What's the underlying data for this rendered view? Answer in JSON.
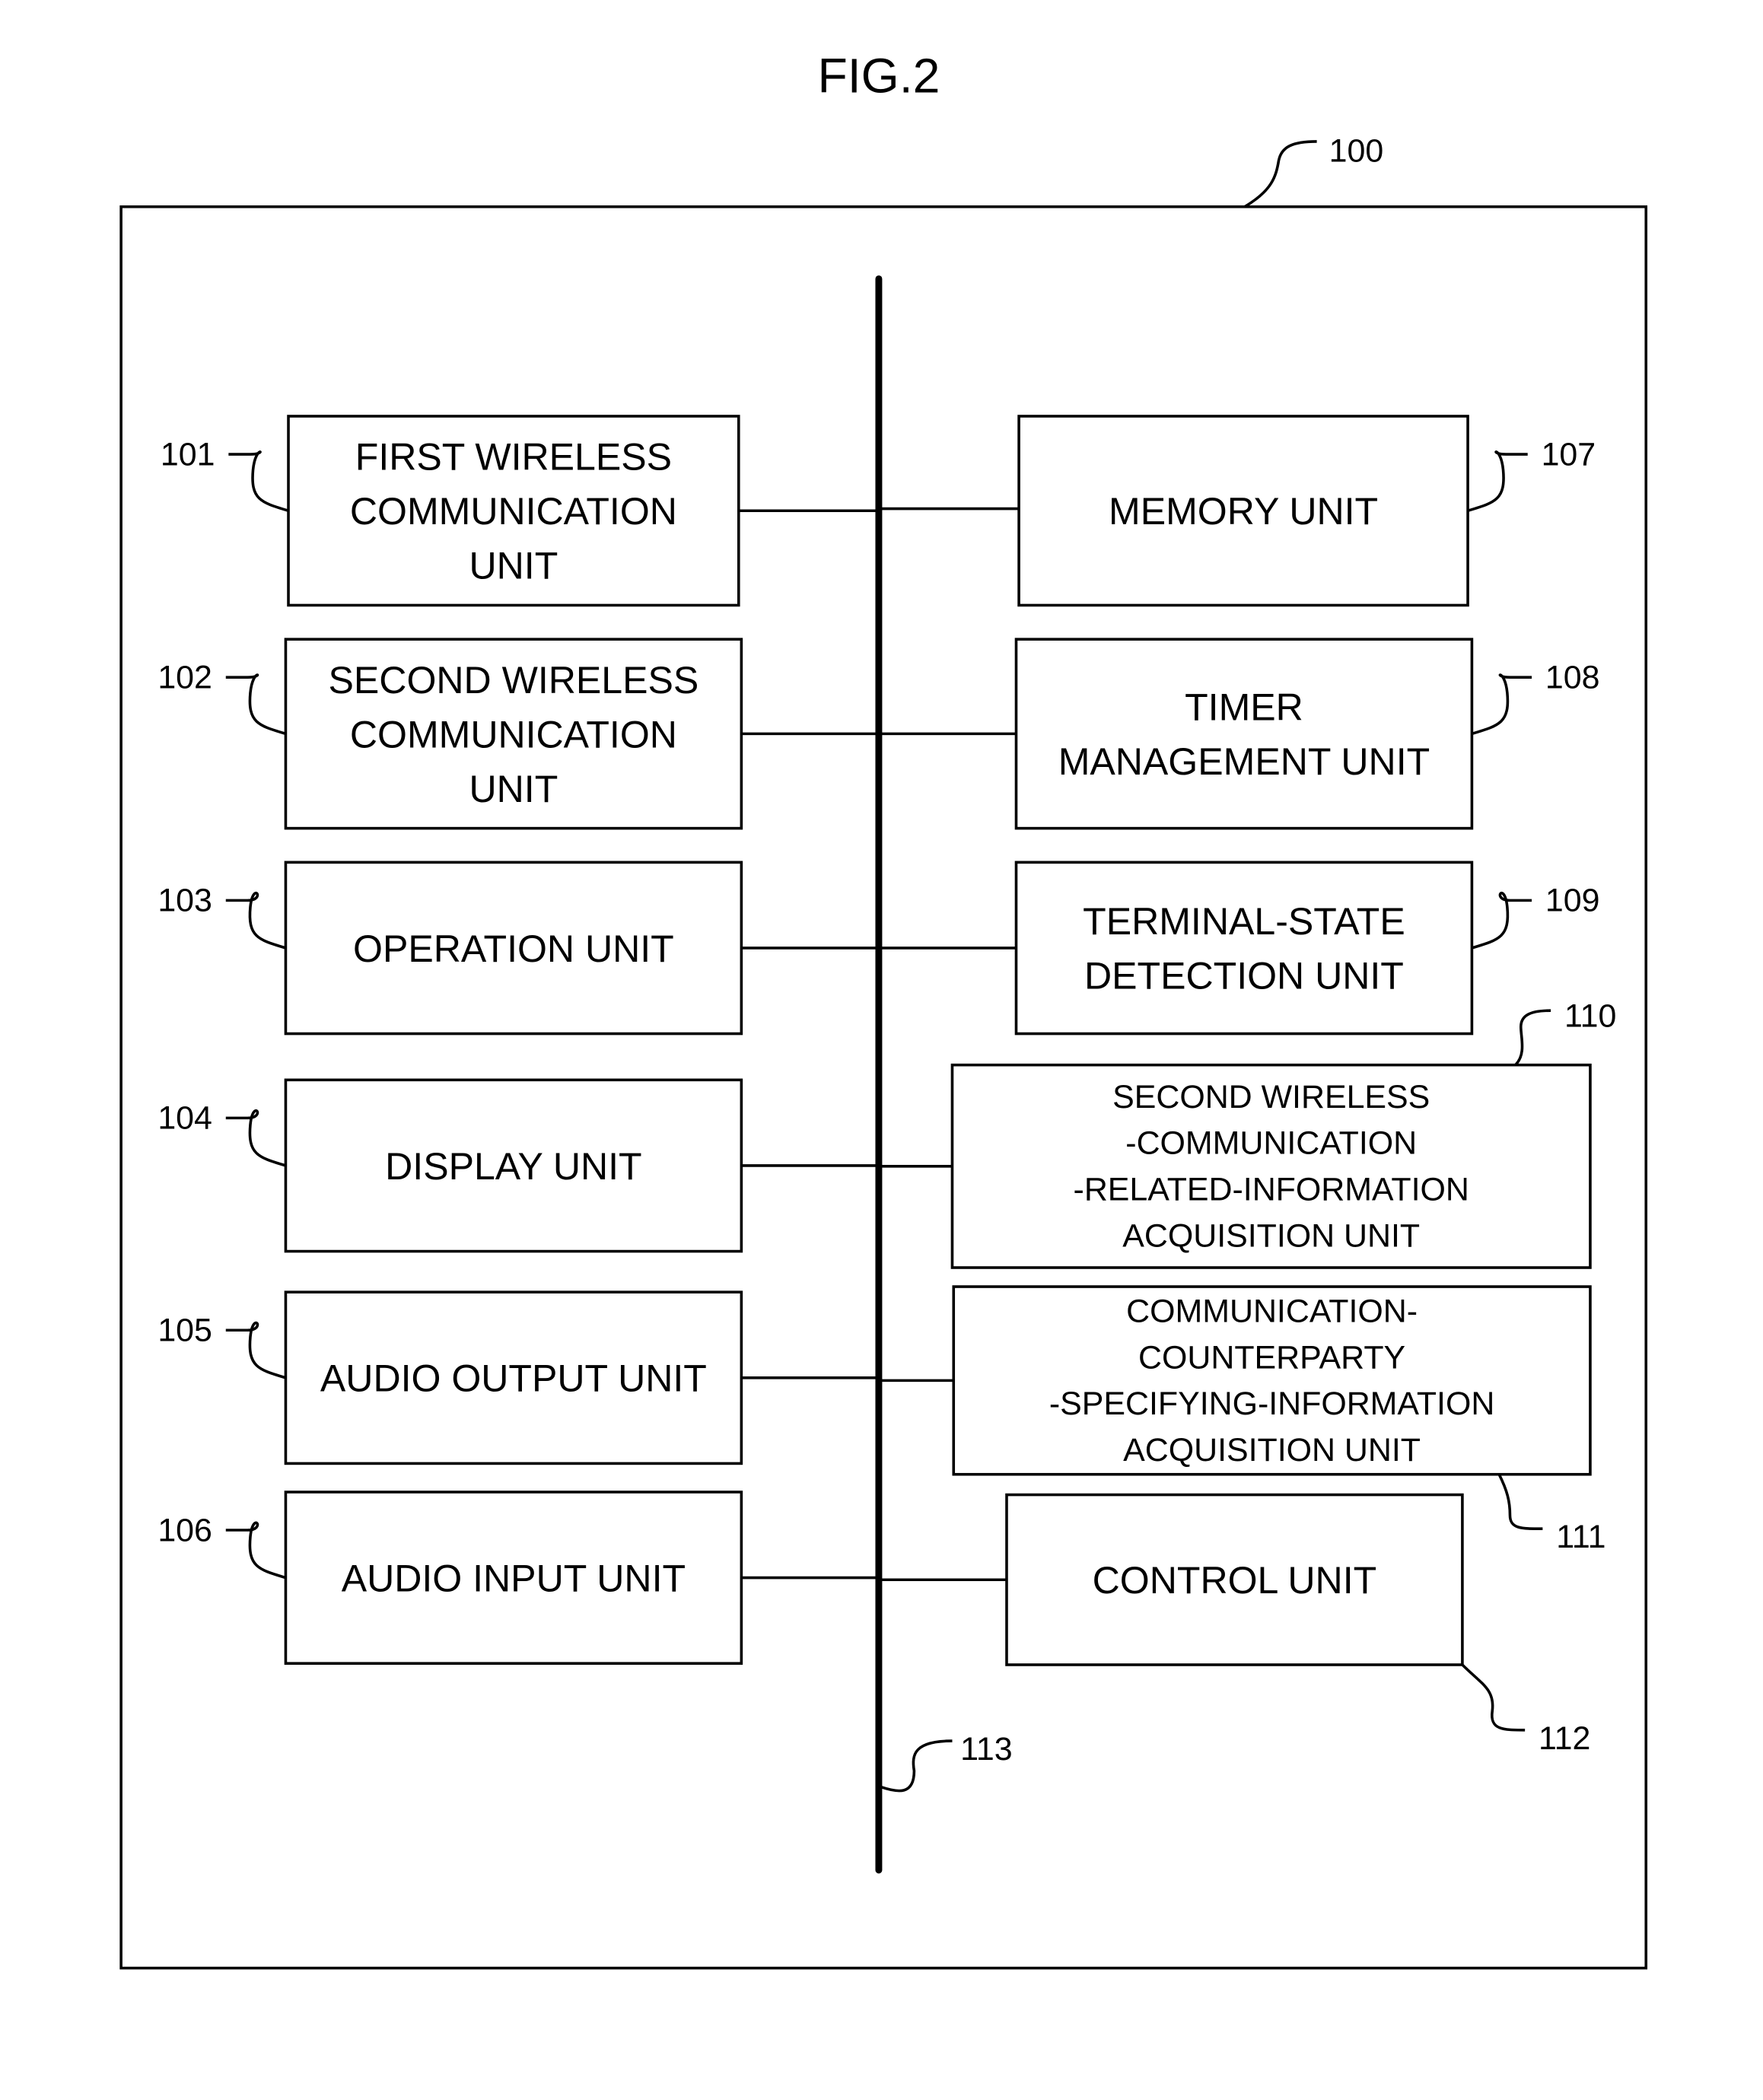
{
  "figure": {
    "title": "FIG.2",
    "device_ref": "100",
    "bus_ref": "113"
  },
  "left_units": [
    {
      "ref": "101",
      "lines": [
        "FIRST WIRELESS",
        "COMMUNICATION",
        "UNIT"
      ]
    },
    {
      "ref": "102",
      "lines": [
        "SECOND WIRELESS",
        "COMMUNICATION",
        "UNIT"
      ]
    },
    {
      "ref": "103",
      "lines": [
        "OPERATION UNIT"
      ]
    },
    {
      "ref": "104",
      "lines": [
        "DISPLAY UNIT"
      ]
    },
    {
      "ref": "105",
      "lines": [
        "AUDIO OUTPUT UNIT"
      ]
    },
    {
      "ref": "106",
      "lines": [
        "AUDIO INPUT UNIT"
      ]
    }
  ],
  "right_units": [
    {
      "ref": "107",
      "lines": [
        "MEMORY UNIT"
      ]
    },
    {
      "ref": "108",
      "lines": [
        "TIMER",
        "MANAGEMENT UNIT"
      ]
    },
    {
      "ref": "109",
      "lines": [
        "TERMINAL-STATE",
        "DETECTION UNIT"
      ]
    },
    {
      "ref": "110",
      "lines": [
        "SECOND WIRELESS",
        "-COMMUNICATION",
        "-RELATED-INFORMATION",
        "ACQUISITION UNIT"
      ]
    },
    {
      "ref": "111",
      "lines": [
        "COMMUNICATION-",
        "COUNTERPARTY",
        "-SPECIFYING-INFORMATION",
        "ACQUISITION UNIT"
      ]
    },
    {
      "ref": "112",
      "lines": [
        "CONTROL UNIT"
      ]
    }
  ]
}
